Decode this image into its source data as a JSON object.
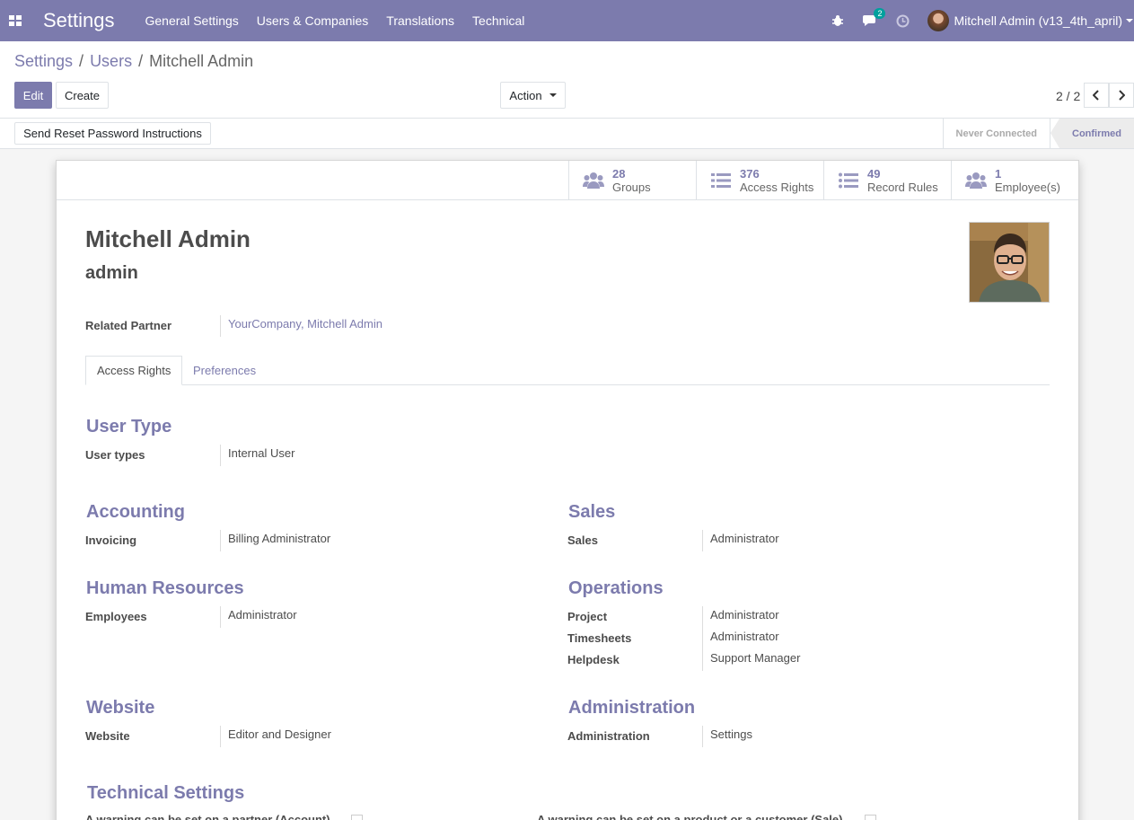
{
  "navbar": {
    "app_title": "Settings",
    "menu": [
      "General Settings",
      "Users & Companies",
      "Translations",
      "Technical"
    ],
    "chat_count": "2",
    "user_name": "Mitchell Admin (v13_4th_april)"
  },
  "breadcrumb": {
    "root": "Settings",
    "parent": "Users",
    "current": "Mitchell Admin",
    "sep": "/"
  },
  "toolbar": {
    "edit": "Edit",
    "create": "Create",
    "action": "Action",
    "pager": "2 / 2"
  },
  "statusbar": {
    "reset_password": "Send Reset Password Instructions",
    "steps": [
      "Never Connected",
      "Confirmed"
    ]
  },
  "stats": [
    {
      "value": "28",
      "label": "Groups",
      "icon": "users-icon"
    },
    {
      "value": "376",
      "label": "Access Rights",
      "icon": "list-icon"
    },
    {
      "value": "49",
      "label": "Record Rules",
      "icon": "list-icon"
    },
    {
      "value": "1",
      "label": "Employee(s)",
      "icon": "users-icon"
    }
  ],
  "user": {
    "name": "Mitchell Admin",
    "login": "admin",
    "related_partner_label": "Related Partner",
    "related_partner_value": "YourCompany, Mitchell Admin"
  },
  "tabs": [
    "Access Rights",
    "Preferences"
  ],
  "access": {
    "user_type": {
      "title": "User Type",
      "label": "User types",
      "value": "Internal User"
    },
    "accounting": {
      "title": "Accounting",
      "label": "Invoicing",
      "value": "Billing Administrator"
    },
    "sales": {
      "title": "Sales",
      "label": "Sales",
      "value": "Administrator"
    },
    "hr": {
      "title": "Human Resources",
      "label": "Employees",
      "value": "Administrator"
    },
    "operations": {
      "title": "Operations",
      "rows": [
        {
          "label": "Project",
          "value": "Administrator"
        },
        {
          "label": "Timesheets",
          "value": "Administrator"
        },
        {
          "label": "Helpdesk",
          "value": "Support Manager"
        }
      ]
    },
    "website": {
      "title": "Website",
      "label": "Website",
      "value": "Editor and Designer"
    },
    "administration": {
      "title": "Administration",
      "label": "Administration",
      "value": "Settings"
    },
    "technical": {
      "title": "Technical Settings",
      "left_label": "A warning can be set on a partner (Account)",
      "right_label": "A warning can be set on a product or a customer (Sale)"
    }
  }
}
